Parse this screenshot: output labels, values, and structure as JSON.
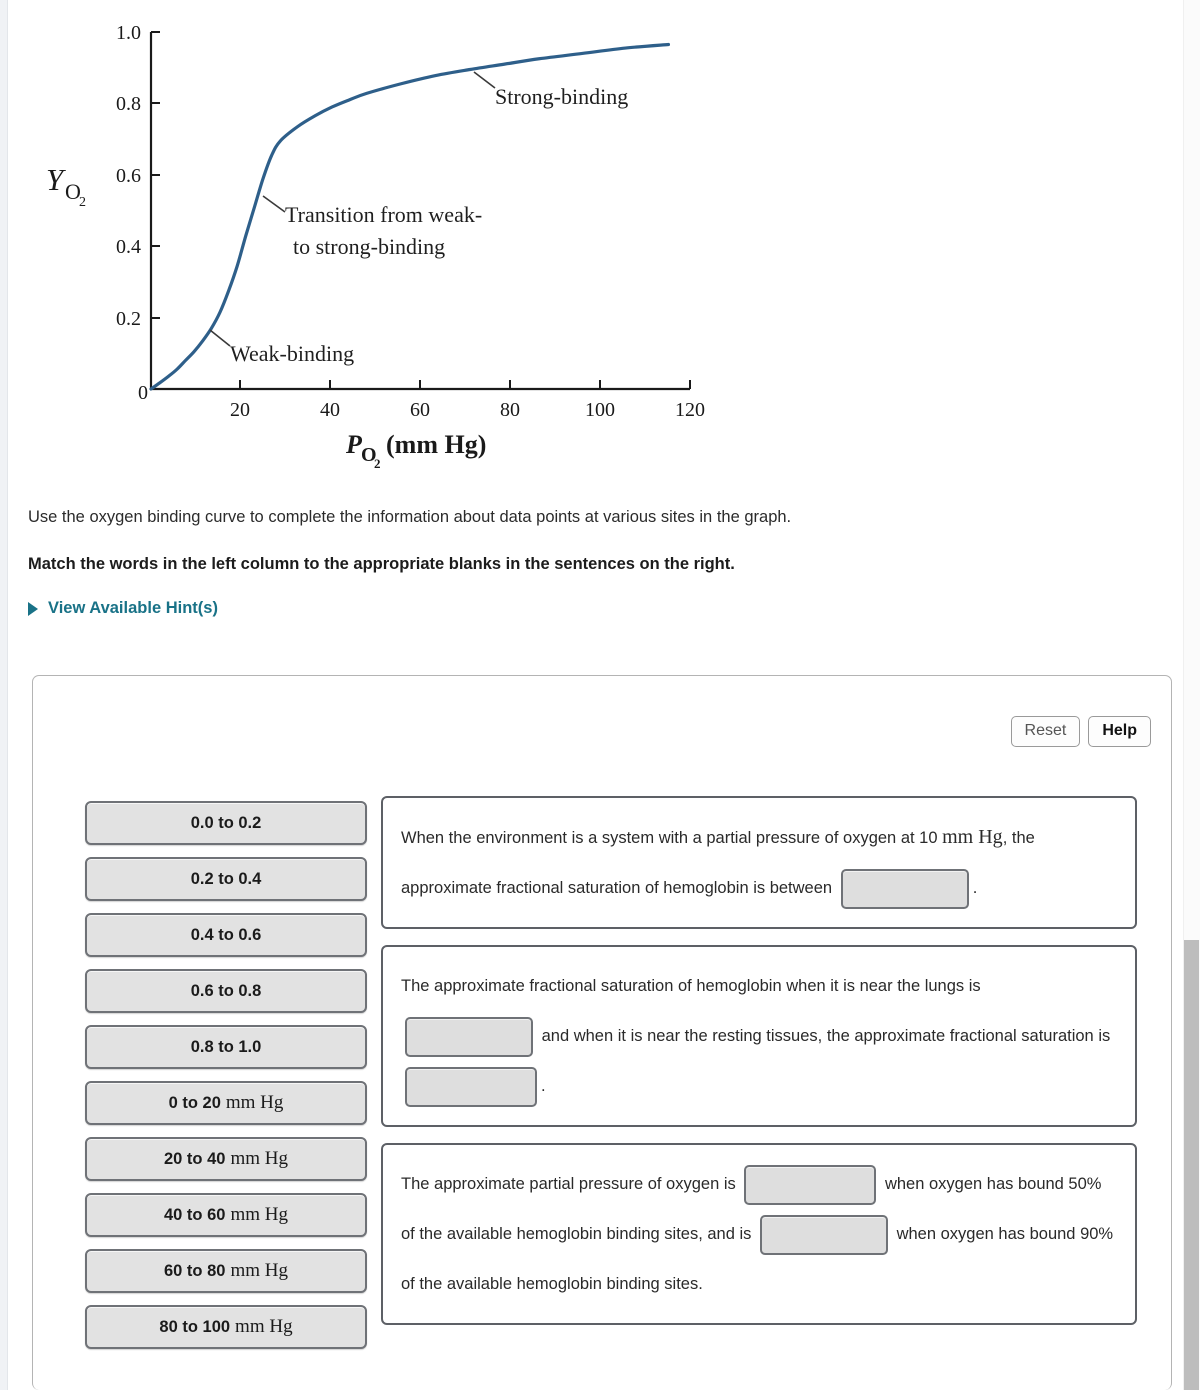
{
  "chart_data": {
    "type": "line",
    "title": "",
    "xlabel": "Po2 (mm Hg)",
    "xlabel_main": "P",
    "xlabel_sub": "O",
    "xlabel_sub2": "2",
    "xlabel_unit": "(mm Hg)",
    "ylabel_main": "Y",
    "ylabel_sub": "O",
    "ylabel_sub2": "2",
    "xlim": [
      0,
      125
    ],
    "ylim": [
      0,
      1.0
    ],
    "grid": false,
    "legend": "none",
    "xticks": [
      "0",
      "20",
      "40",
      "60",
      "80",
      "100",
      "120"
    ],
    "xtick_values": [
      0,
      20,
      40,
      60,
      80,
      100,
      120
    ],
    "yticks": [
      "0",
      "0.2",
      "0.4",
      "0.6",
      "0.8",
      "1.0"
    ],
    "ytick_values": [
      0,
      0.2,
      0.4,
      0.6,
      0.8,
      1.0
    ],
    "series_name": "oxygen binding curve (hemoglobin)",
    "line_color": "#2e5f8a",
    "x": [
      0,
      2,
      4,
      6,
      8,
      10,
      12,
      14,
      16,
      18,
      20,
      22,
      24,
      26,
      28,
      30,
      34,
      38,
      42,
      46,
      50,
      58,
      66,
      74,
      82,
      90,
      100,
      110,
      120
    ],
    "y": [
      0.0,
      0.017,
      0.035,
      0.055,
      0.08,
      0.105,
      0.135,
      0.17,
      0.215,
      0.275,
      0.345,
      0.43,
      0.51,
      0.59,
      0.655,
      0.695,
      0.735,
      0.765,
      0.79,
      0.81,
      0.828,
      0.855,
      0.878,
      0.895,
      0.91,
      0.925,
      0.94,
      0.955,
      0.965
    ],
    "annotations": [
      {
        "text": "Strong-binding",
        "at_x": 72,
        "at_y": 0.878,
        "label_x": 82,
        "label_y": 0.8
      },
      {
        "text_line1": "Transition from weak-",
        "text_line2": "to strong-binding",
        "at_x": 25,
        "at_y": 0.545,
        "label_x": 31,
        "label_y": 0.47
      },
      {
        "text": "Weak-binding",
        "at_x": 14,
        "at_y": 0.17,
        "label_x": 19,
        "label_y": 0.105
      }
    ]
  },
  "prose": {
    "intro": "Use the oxygen binding curve to complete the information about data points at various sites in the graph.",
    "instruction": "Match the words in the left column to the appropriate blanks in the sentences on the right.",
    "hint_link": "View Available Hint(s)",
    "hint_icon": "triangle-right-icon"
  },
  "toolbar": {
    "reset_label": "Reset",
    "help_label": "Help"
  },
  "bank": {
    "items": [
      {
        "label": "0.0 to 0.2",
        "unit": ""
      },
      {
        "label": "0.2 to 0.4",
        "unit": ""
      },
      {
        "label": "0.4 to 0.6",
        "unit": ""
      },
      {
        "label": "0.6 to 0.8",
        "unit": ""
      },
      {
        "label": "0.8 to 1.0",
        "unit": ""
      },
      {
        "label": "0 to 20",
        "unit": "mm Hg"
      },
      {
        "label": "20 to 40",
        "unit": "mm Hg"
      },
      {
        "label": "40 to 60",
        "unit": "mm Hg"
      },
      {
        "label": "60 to 80",
        "unit": "mm Hg"
      },
      {
        "label": "80 to 100",
        "unit": "mm Hg"
      }
    ]
  },
  "statements": [
    {
      "id": "statement-1",
      "frag_1": "When the environment is a system with a partial pressure of oxygen at 10",
      "frag_2": "mm Hg",
      "frag_3": ", the approximate fractional saturation of hemoglobin is between",
      "frag_4": ".",
      "slots": 1
    },
    {
      "id": "statement-2",
      "frag_1": "The approximate fractional saturation of hemoglobin when it is near the lungs is",
      "frag_2": "and when it is near the resting tissues, the approximate fractional saturation is",
      "frag_3": ".",
      "slots": 2
    },
    {
      "id": "statement-3",
      "frag_1": "The approximate partial pressure of oxygen is",
      "frag_2": "when oxygen has bound 50% of the available hemoglobin binding sites, and is",
      "frag_3": "when oxygen has bound 90% of the available hemoglobin binding sites.",
      "slots": 2
    }
  ],
  "colors": {
    "curve": "#2e5f8a",
    "hint_link": "#197287",
    "tile_fill": "#e2e2e2",
    "tile_border": "#6f7277",
    "scrollbar_thumb": "#bdbdbd"
  }
}
